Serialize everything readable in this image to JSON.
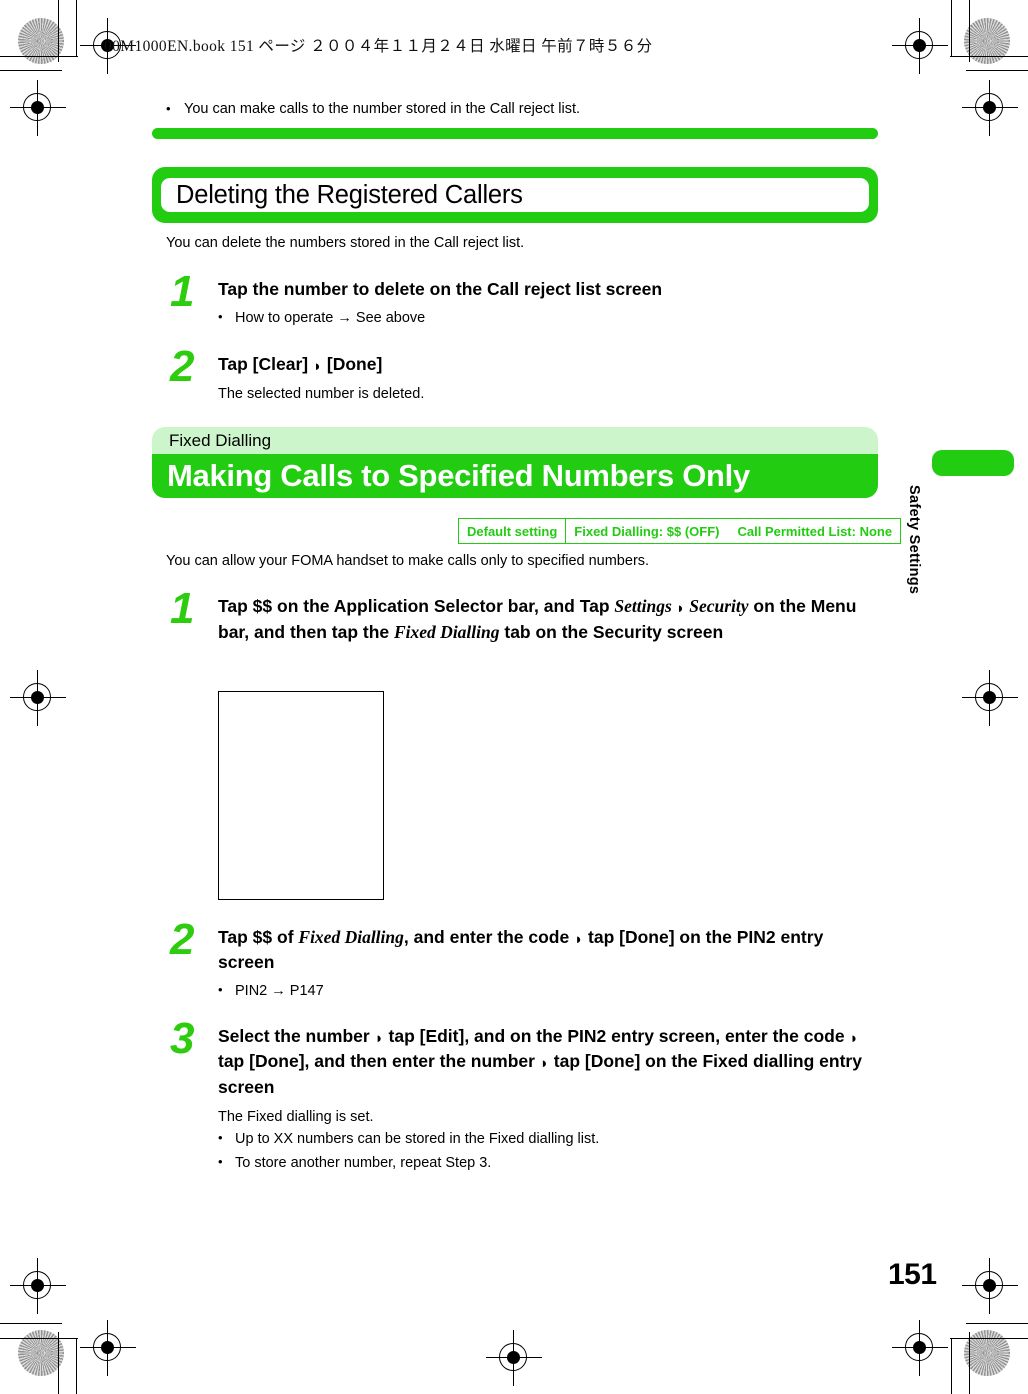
{
  "file_header": "00M1000EN.book   151 ページ   ２００４年１１月２４日   水曜日   午前７時５６分",
  "top_note": {
    "bullet": "•",
    "text": "You can make calls to the number stored in the Call reject list."
  },
  "section_delete": {
    "heading": "Deleting the Registered Callers",
    "intro": "You can delete the numbers stored in the Call reject list.",
    "steps": [
      {
        "num": "1",
        "title": "Tap the number to delete on the Call reject list screen",
        "sub_bullet": "•",
        "sub": "How to operate → See above"
      },
      {
        "num": "2",
        "title_pre": "Tap [Clear] ",
        "title_arrow": "◗",
        "title_post": " [Done]",
        "desc": "The selected number is deleted."
      }
    ]
  },
  "section_fixed": {
    "banner_label": "Fixed Dialling",
    "banner_title": "Making Calls to Specified Numbers Only",
    "default_table": {
      "header": "Default setting",
      "value_1": "Fixed Dialling: $$ (OFF)",
      "value_2": "Call Permitted List: None"
    },
    "intro": "You can allow your FOMA handset to make calls only to specified numbers.",
    "step1": {
      "num": "1",
      "t1": "Tap $$ on the Application Selector bar, and Tap ",
      "ui1": "Settings",
      "arrow1": "◗",
      "ui2": "Security",
      "t2": " on the Menu bar, and then tap the ",
      "ui3": "Fixed Dialling",
      "t3": " tab on the Security screen"
    },
    "step2": {
      "num": "2",
      "t1": "Tap $$ of ",
      "ui1": "Fixed Dialling",
      "t2": ", and enter the code ",
      "arrow1": "◗",
      "t3": " tap [Done] on the PIN2 entry screen",
      "sub_bullet": "•",
      "sub": "PIN2 → P147"
    },
    "step3": {
      "num": "3",
      "t1": "Select the number ",
      "arrow1": "◗",
      "t2": " tap [Edit], and on the PIN2 entry screen, enter the code ",
      "arrow2": "◗",
      "t3": " tap [Done], and then enter the number ",
      "arrow3": "◗",
      "t4": " tap [Done] on the Fixed dialling entry screen",
      "desc": "The Fixed dialling is set.",
      "sub_bullet_1": "•",
      "sub_1": "Up to XX numbers can be stored in the Fixed dialling list.",
      "sub_bullet_2": "•",
      "sub_2": "To store another number, repeat Step 3."
    }
  },
  "side_tab_label": "Safety Settings",
  "page_number": "151",
  "colors": {
    "green": "#22CC11",
    "light_green": "#CCF5CC",
    "step_number_green": "#2ECC0E"
  }
}
